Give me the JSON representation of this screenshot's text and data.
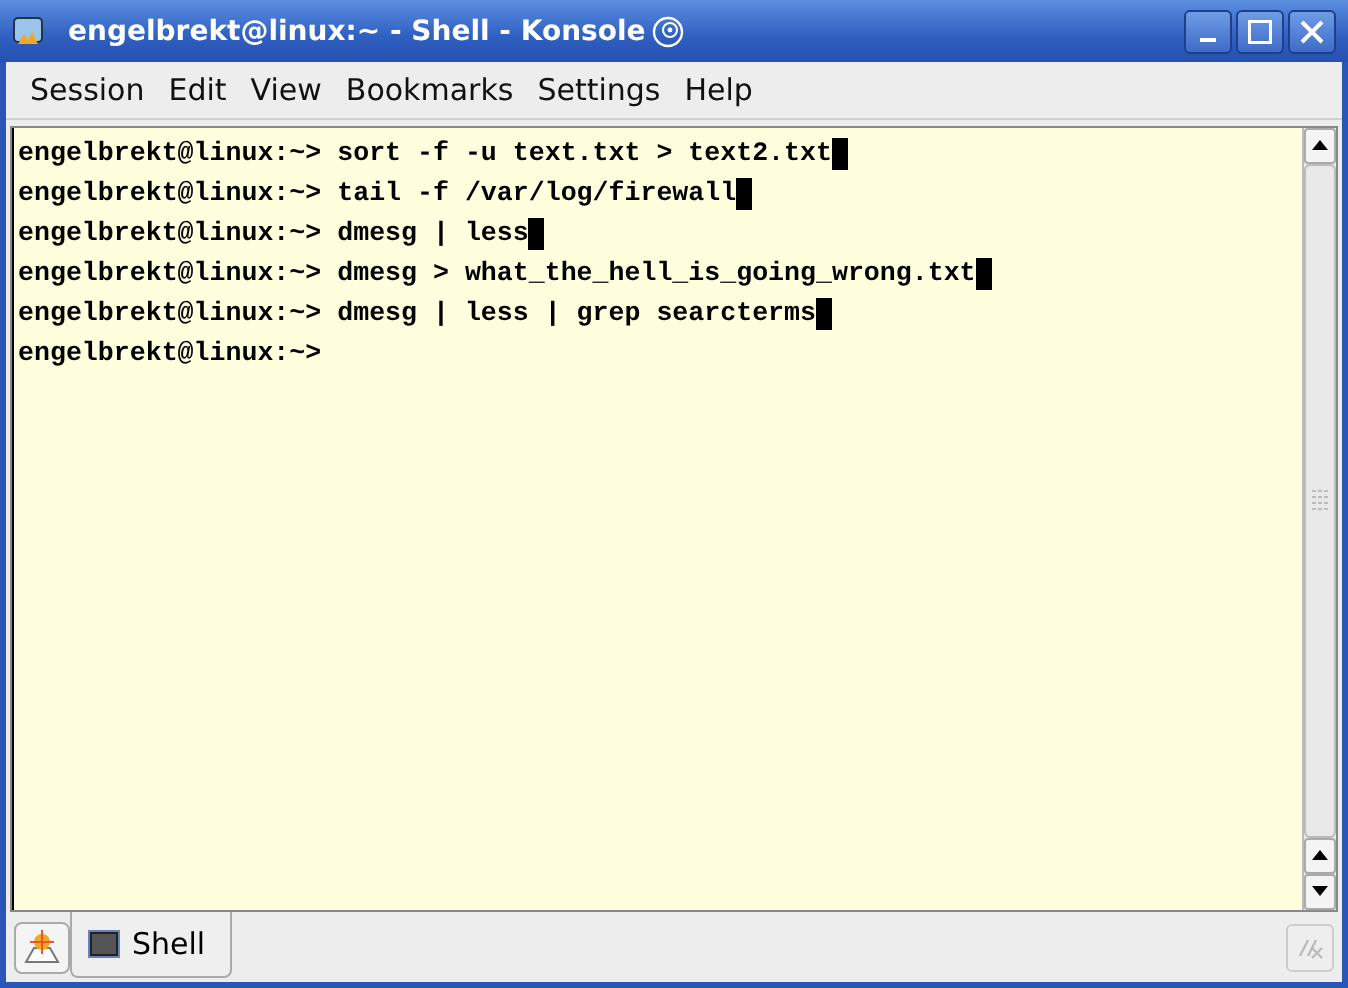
{
  "window": {
    "title": "engelbrekt@linux:~ - Shell - Konsole"
  },
  "menu": [
    "Session",
    "Edit",
    "View",
    "Bookmarks",
    "Settings",
    "Help"
  ],
  "terminal": {
    "lines": [
      {
        "prompt": "engelbrekt@linux:~>",
        "command": "sort -f -u text.txt > text2.txt",
        "cursor": true
      },
      {
        "prompt": "engelbrekt@linux:~>",
        "command": "tail -f /var/log/firewall",
        "cursor": true
      },
      {
        "prompt": "engelbrekt@linux:~>",
        "command": "dmesg | less",
        "cursor": true
      },
      {
        "prompt": "engelbrekt@linux:~>",
        "command": "dmesg > what_the_hell_is_going_wrong.txt",
        "cursor": true
      },
      {
        "prompt": "engelbrekt@linux:~>",
        "command": "dmesg | less | grep searcterms",
        "cursor": true
      },
      {
        "prompt": "engelbrekt@linux:~>",
        "cursor": false
      }
    ]
  },
  "tabs": [
    {
      "label": "Shell",
      "selected": true
    }
  ]
}
